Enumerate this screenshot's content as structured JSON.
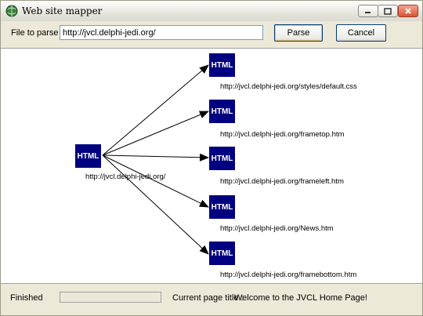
{
  "window": {
    "title": "Web site mapper"
  },
  "toolbar": {
    "file_label": "File to parse",
    "url_value": "http://jvcl.delphi-jedi.org/",
    "parse_label": "Parse",
    "cancel_label": "Cancel"
  },
  "graph": {
    "root": {
      "icon_text": "HTML",
      "url": "http://jvcl.delphi-jedi.org/"
    },
    "children": [
      {
        "icon_text": "HTML",
        "url": "http://jvcl.delphi-jedi.org/styles/default.css"
      },
      {
        "icon_text": "HTML",
        "url": "http://jvcl.delphi-jedi.org/frametop.htm"
      },
      {
        "icon_text": "HTML",
        "url": "http://jvcl.delphi-jedi.org/frameleft.htm"
      },
      {
        "icon_text": "HTML",
        "url": "http://jvcl.delphi-jedi.org/News.htm"
      },
      {
        "icon_text": "HTML",
        "url": "http://jvcl.delphi-jedi.org/framebottom.htm"
      }
    ]
  },
  "status": {
    "state": "Finished",
    "progress": 0,
    "page_title_label": "Current page title :",
    "page_title_value": "Welcome to the JVCL Home Page!"
  },
  "colors": {
    "node_fill": "#000080",
    "node_text": "#ffffff",
    "edge": "#000000"
  }
}
